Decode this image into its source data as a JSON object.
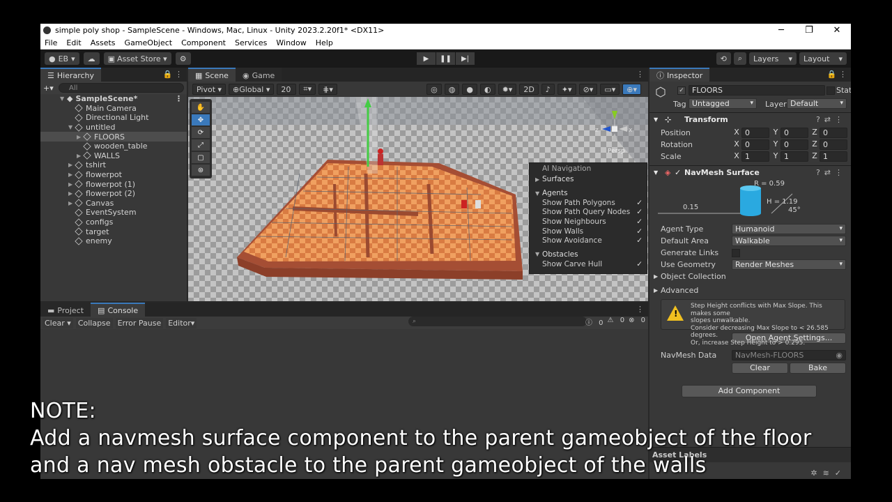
{
  "window": {
    "title": "simple poly shop - SampleScene - Windows, Mac, Linux - Unity 2023.2.20f1* <DX11>",
    "controls": [
      "─",
      "❐",
      "✕"
    ]
  },
  "menu": [
    "File",
    "Edit",
    "Assets",
    "GameObject",
    "Component",
    "Services",
    "Window",
    "Help"
  ],
  "toolbar": {
    "account": "EB",
    "asset_store": "Asset Store",
    "layers": "Layers",
    "layout": "Layout"
  },
  "hierarchy": {
    "tab": "Hierarchy",
    "search_placeholder": "All",
    "scene": "SampleScene*",
    "items": [
      {
        "label": "Main Camera",
        "depth": 1
      },
      {
        "label": "Directional Light",
        "depth": 1
      },
      {
        "label": "untitled",
        "depth": 1,
        "fold": "open"
      },
      {
        "label": "FLOORS",
        "depth": 2,
        "fold": "closed",
        "selected": true
      },
      {
        "label": "wooden_table",
        "depth": 2
      },
      {
        "label": "WALLS",
        "depth": 2,
        "fold": "closed"
      },
      {
        "label": "tshirt",
        "depth": 1,
        "fold": "closed"
      },
      {
        "label": "flowerpot",
        "depth": 1,
        "fold": "closed"
      },
      {
        "label": "flowerpot (1)",
        "depth": 1,
        "fold": "closed"
      },
      {
        "label": "flowerpot (2)",
        "depth": 1,
        "fold": "closed"
      },
      {
        "label": "Canvas",
        "depth": 1,
        "fold": "closed"
      },
      {
        "label": "EventSystem",
        "depth": 1
      },
      {
        "label": "configs",
        "depth": 1
      },
      {
        "label": "target",
        "depth": 1
      },
      {
        "label": "enemy",
        "depth": 1
      }
    ]
  },
  "scene": {
    "tabs": [
      "Scene",
      "Game"
    ],
    "pivot": "Pivot",
    "global": "Global",
    "grid_size": "20",
    "mode_2d": "2D",
    "persp": "Persp",
    "ai_nav": {
      "title": "AI Navigation",
      "surfaces": "Surfaces",
      "agents": "Agents",
      "agent_items": [
        "Show Path Polygons",
        "Show Path Query Nodes",
        "Show Neighbours",
        "Show Walls",
        "Show Avoidance"
      ],
      "obstacles": "Obstacles",
      "obstacle_items": [
        "Show Carve Hull"
      ],
      "check": "✓"
    }
  },
  "console": {
    "tabs": [
      "Project",
      "Console"
    ],
    "buttons": [
      "Clear",
      "Collapse",
      "Error Pause",
      "Editor"
    ],
    "counts": [
      "0",
      "0",
      "0"
    ]
  },
  "inspector": {
    "tab": "Inspector",
    "object_name": "FLOORS",
    "static_label": "Static",
    "tag_label": "Tag",
    "tag_value": "Untagged",
    "layer_label": "Layer",
    "layer_value": "Default",
    "transform": {
      "title": "Transform",
      "rows": [
        {
          "label": "Position",
          "x": "0",
          "y": "0",
          "z": "0"
        },
        {
          "label": "Rotation",
          "x": "0",
          "y": "0",
          "z": "0"
        },
        {
          "label": "Scale",
          "x": "1",
          "y": "1",
          "z": "1"
        }
      ]
    },
    "navmesh": {
      "title": "NavMesh Surface",
      "radius": "R = 0.59",
      "height": "H = 1.19",
      "step": "0.15",
      "slope": "45°",
      "fields": [
        {
          "label": "Agent Type",
          "value": "Humanoid"
        },
        {
          "label": "Default Area",
          "value": "Walkable"
        },
        {
          "label": "Generate Links",
          "value": ""
        },
        {
          "label": "Use Geometry",
          "value": "Render Meshes"
        }
      ],
      "object_collection": "Object Collection",
      "advanced": "Advanced",
      "warning": [
        "Step Height conflicts with Max Slope. This makes some",
        "slopes unwalkable.",
        "Consider decreasing Max Slope to < 26.585 degrees.",
        "Or, increase Step Height to > 0.295."
      ],
      "open_agent_settings": "Open Agent Settings...",
      "navmesh_data_label": "NavMesh Data",
      "navmesh_data_value": "NavMesh-FLOORS",
      "clear": "Clear",
      "bake": "Bake"
    },
    "add_component": "Add Component",
    "asset_labels": "Asset Labels"
  },
  "note": {
    "line1": "NOTE:",
    "line2": "Add a navmesh surface component to the parent gameobject of the floor",
    "line3": "and a nav mesh obstacle to the parent gameobject of the walls"
  },
  "colors": {
    "accent": "#3a79bb",
    "floor": "#e8864a",
    "wall": "#b8553a",
    "warning": "#f0c020"
  }
}
